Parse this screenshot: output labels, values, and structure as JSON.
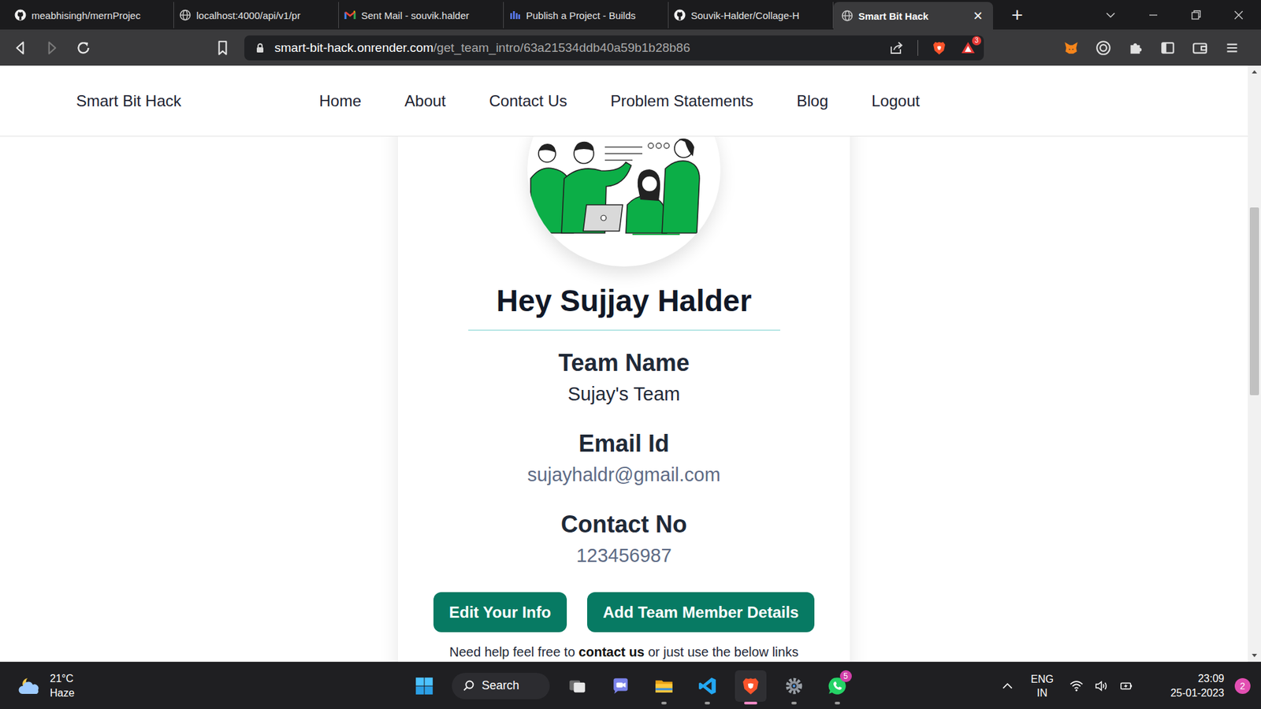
{
  "browser": {
    "tabs": [
      {
        "label": "meabhisingh/mernProjec",
        "kind": "github",
        "selected": false
      },
      {
        "label": "localhost:4000/api/v1/pr",
        "kind": "globe",
        "selected": false
      },
      {
        "label": "Sent Mail - souvik.halder",
        "kind": "gmail",
        "selected": false
      },
      {
        "label": "Publish a Project - Builds",
        "kind": "builds",
        "selected": false
      },
      {
        "label": "Souvik-Halder/Collage-H",
        "kind": "github",
        "selected": false
      },
      {
        "label": "Smart Bit Hack",
        "kind": "globe",
        "selected": true
      }
    ],
    "close_tab": "×",
    "new_tab": "+",
    "address": {
      "domain": "smart-bit-hack.onrender.com",
      "path": "/get_team_intro/63a21534ddb40a59b1b28b86"
    },
    "rewards_badge": "3"
  },
  "page": {
    "brand": "Smart Bit Hack",
    "nav": [
      "Home",
      "About",
      "Contact Us",
      "Problem Statements",
      "Blog",
      "Logout"
    ],
    "greeting": "Hey Sujjay Halder",
    "fields": [
      {
        "label": "Team Name",
        "value": "Sujay's Team",
        "muted": false
      },
      {
        "label": "Email Id",
        "value": "sujayhaldr@gmail.com",
        "muted": true
      },
      {
        "label": "Contact No",
        "value": "123456987",
        "muted": true
      }
    ],
    "buttons": [
      "Edit Your Info",
      "Add Team Member Details"
    ],
    "help": {
      "before": "Need help feel free to ",
      "link": "contact us",
      "after": " or just use the below links"
    }
  },
  "taskbar": {
    "weather": {
      "temp": "21°C",
      "condition": "Haze"
    },
    "search": "Search",
    "apps": [
      {
        "kind": "taskview",
        "running": false,
        "active": false
      },
      {
        "kind": "chat",
        "running": false,
        "active": false
      },
      {
        "kind": "explorer",
        "running": true,
        "active": false
      },
      {
        "kind": "vscode",
        "running": true,
        "active": false
      },
      {
        "kind": "brave",
        "running": true,
        "active": true
      },
      {
        "kind": "settings",
        "running": true,
        "active": false
      },
      {
        "kind": "whatsapp",
        "running": true,
        "active": false,
        "badge": "5"
      }
    ],
    "language": {
      "top": "ENG",
      "bottom": "IN"
    },
    "time": "23:09",
    "date": "25-01-2023",
    "notifications": "2"
  }
}
